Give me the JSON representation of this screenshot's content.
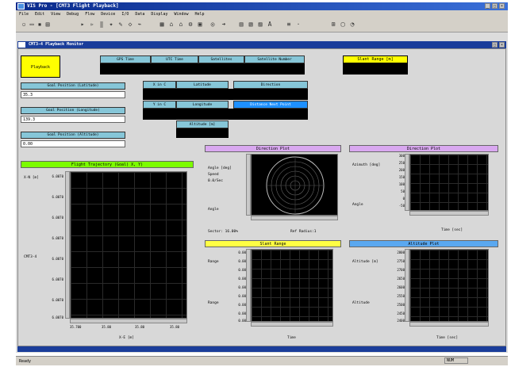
{
  "window": {
    "title": "VIS Pro - [CMT3 Flight Playback]"
  },
  "menu": [
    "File",
    "Edit",
    "View",
    "Debug",
    "Flow",
    "Device",
    "I/O",
    "Data",
    "Display",
    "Window",
    "Help"
  ],
  "child": {
    "title": "CMT3-4 Playback Monitor"
  },
  "playback_label": "Playback",
  "gps_headers": [
    "GPS Time",
    "UTC Time",
    "Satellites",
    "Satellite Number"
  ],
  "slant_range_header": "Slant Range [m]",
  "nav": {
    "x": "X in C",
    "y": "Y in C",
    "latitude": "Latitude",
    "longitude": "Longitude",
    "altitude": "Altitude [m]",
    "direction": "Direction",
    "dist_next": "Distance Next Point"
  },
  "goal": {
    "lat_label": "Goal Position (Latitude)",
    "lat_value": "35.3",
    "lon_label": "Goal Position (Longitude)",
    "lon_value": "139.3",
    "alt_label": "Goal Position (Altitude)",
    "alt_value": "0.00"
  },
  "trajectory": {
    "title": "Flight Trajectory (Goal) X, Y)",
    "ylabel": "X-N [m]",
    "xlabel": "X-E [m]",
    "yticks": [
      "6.0070",
      "6.0070",
      "6.0070",
      "6.0070",
      "6.0070",
      "6.0070",
      "6.0070",
      "6.0070"
    ],
    "xticks": [
      "35.700",
      "35.80",
      "35.80",
      "35.80"
    ],
    "mid_label": "CMT3-4"
  },
  "direction_plot": {
    "title": "Direction Plot",
    "labels": [
      "Angle [deg]",
      "Speed",
      "0.0/Sec",
      "Angle"
    ],
    "footer_left": "Sector: 16.00%",
    "footer_right": "Ref Radius:1"
  },
  "direction_time": {
    "title": "Direction Plot",
    "ylabel": "Azimuth [deg]",
    "ylabel2": "Angle",
    "yticks": [
      "300",
      "250",
      "200",
      "150",
      "100",
      "50",
      "0",
      "-50"
    ],
    "xlabel": "Time [sec]"
  },
  "slant_range": {
    "title": "Slant Range",
    "ylabel": "Range",
    "ylabel2": "Range",
    "yticks": [
      "0.00",
      "0.00",
      "0.00",
      "0.00",
      "0.00",
      "0.00",
      "0.00",
      "0.00",
      "0.00"
    ],
    "xlabel": "Time"
  },
  "altitude_plot": {
    "title": "Altitude Plot",
    "ylabel": "Altitude [m]",
    "ylabel2": "Altitude",
    "yticks": [
      "2800",
      "2750",
      "2700",
      "2650",
      "2600",
      "2550",
      "2500",
      "2450",
      "2400"
    ],
    "xlabel": "Time [sec]"
  },
  "status": {
    "left": "Ready",
    "right": "NUM"
  },
  "colors": {
    "yellow": "#ffff00",
    "cyan": "#86c6d8",
    "green": "#7cfc00",
    "lavender": "#d9a8f0",
    "blue": "#5aa8f0"
  }
}
